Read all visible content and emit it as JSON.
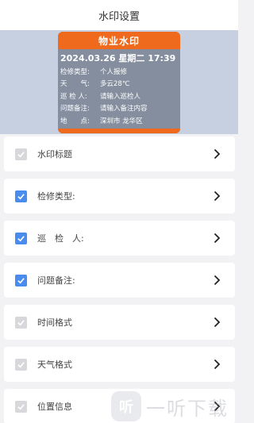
{
  "header": {
    "title": "水印设置"
  },
  "watermark": {
    "title": "物业水印",
    "datetime": "2024.03.26 星期二 17:39",
    "fields": [
      {
        "key": "检修类型:",
        "value": "个人报修"
      },
      {
        "key": "天　　气:",
        "value": "多云28℃"
      },
      {
        "key": "巡 检 人:",
        "value": "请输入巡检人"
      },
      {
        "key": "问题备注:",
        "value": "请输入备注内容"
      },
      {
        "key": "地　　点:",
        "value": "深圳市 龙华区"
      }
    ],
    "colors": {
      "accent": "#ef6a1c",
      "body": "#7a8392"
    }
  },
  "settings": [
    {
      "label": "水印标题",
      "checked": true,
      "enabled": false
    },
    {
      "label": "检修类型:",
      "checked": true,
      "enabled": true
    },
    {
      "label": "巡　检　人:",
      "checked": true,
      "enabled": true
    },
    {
      "label": "问题备注:",
      "checked": true,
      "enabled": true
    },
    {
      "label": "时间格式",
      "checked": true,
      "enabled": false
    },
    {
      "label": "天气格式",
      "checked": true,
      "enabled": false
    },
    {
      "label": "位置信息",
      "checked": true,
      "enabled": false
    }
  ],
  "icons": {
    "check": "checkmark-icon",
    "chevron": "chevron-right-icon"
  },
  "overlay_logo": {
    "text": "一听下载",
    "glyph": "听"
  },
  "colors": {
    "checked": "#4a8bee",
    "disabled": "#d8d8dc",
    "preview_bg": "#c6d0e0"
  }
}
